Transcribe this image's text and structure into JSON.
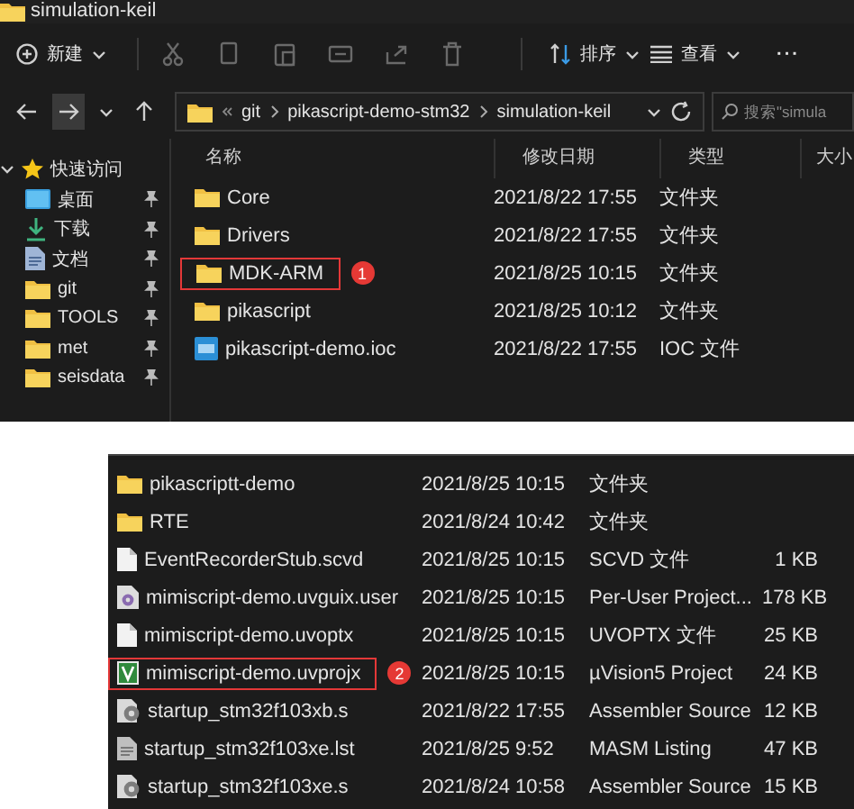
{
  "top_window": {
    "title": "simulation-keil",
    "toolbar": {
      "new_label": "新建",
      "sort_label": "排序",
      "view_label": "查看",
      "more": "···"
    },
    "address": {
      "path": [
        "git",
        "pikascript-demo-stm32",
        "simulation-keil"
      ]
    },
    "search": {
      "placeholder": "搜索\"simula"
    },
    "sidebar": {
      "items": [
        {
          "label": "快速访问",
          "kind": "star",
          "expanded": true,
          "children": [
            {
              "label": "桌面",
              "kind": "desktop",
              "pinned": true
            },
            {
              "label": "下载",
              "kind": "download",
              "pinned": true
            },
            {
              "label": "文档",
              "kind": "document",
              "pinned": true
            },
            {
              "label": "git",
              "kind": "folder",
              "pinned": true
            },
            {
              "label": "TOOLS",
              "kind": "folder",
              "pinned": true
            },
            {
              "label": "met",
              "kind": "folder",
              "pinned": true
            },
            {
              "label": "seisdata",
              "kind": "folder",
              "pinned": true
            }
          ]
        }
      ]
    },
    "columns": [
      "名称",
      "修改日期",
      "类型",
      "大小"
    ],
    "rows": [
      {
        "name": "Core",
        "date": "2021/8/22 17:55",
        "type": "文件夹",
        "kind": "folder"
      },
      {
        "name": "Drivers",
        "date": "2021/8/22 17:55",
        "type": "文件夹",
        "kind": "folder"
      },
      {
        "name": "MDK-ARM",
        "date": "2021/8/25 10:15",
        "type": "文件夹",
        "kind": "folder",
        "callout": "1"
      },
      {
        "name": "pikascript",
        "date": "2021/8/25 10:12",
        "type": "文件夹",
        "kind": "folder"
      },
      {
        "name": "pikascript-demo.ioc",
        "date": "2021/8/22 17:55",
        "type": "IOC 文件",
        "kind": "ioc"
      }
    ]
  },
  "bottom_window": {
    "rows": [
      {
        "name": "pikascriptt-demo",
        "date": "2021/8/25 10:15",
        "type": "文件夹",
        "kind": "folder"
      },
      {
        "name": "RTE",
        "date": "2021/8/24 10:42",
        "type": "文件夹",
        "kind": "folder"
      },
      {
        "name": "EventRecorderStub.scvd",
        "date": "2021/8/25 10:15",
        "type": "SCVD 文件",
        "size": "1 KB",
        "kind": "file"
      },
      {
        "name": "mimiscript-demo.uvguix.user",
        "date": "2021/8/25 10:15",
        "type": "Per-User Project...",
        "size": "178 KB",
        "kind": "user"
      },
      {
        "name": "mimiscript-demo.uvoptx",
        "date": "2021/8/25 10:15",
        "type": "UVOPTX 文件",
        "size": "25 KB",
        "kind": "file"
      },
      {
        "name": "mimiscript-demo.uvprojx",
        "date": "2021/8/25 10:15",
        "type": "µVision5 Project",
        "size": "24 KB",
        "kind": "project",
        "callout": "2"
      },
      {
        "name": "startup_stm32f103xb.s",
        "date": "2021/8/22 17:55",
        "type": "Assembler Source",
        "size": "12 KB",
        "kind": "asm"
      },
      {
        "name": "startup_stm32f103xe.lst",
        "date": "2021/8/25 9:52",
        "type": "MASM Listing",
        "size": "47 KB",
        "kind": "listing"
      },
      {
        "name": "startup_stm32f103xe.s",
        "date": "2021/8/24 10:58",
        "type": "Assembler Source",
        "size": "15 KB",
        "kind": "asm"
      }
    ]
  }
}
